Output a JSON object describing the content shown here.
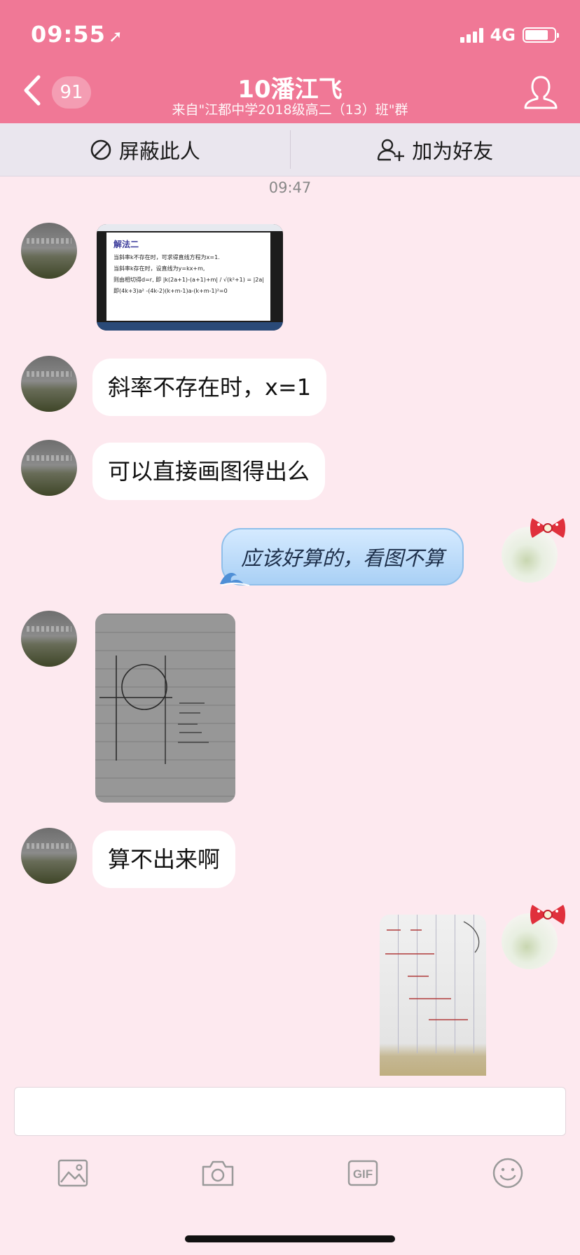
{
  "status_bar": {
    "time": "09:55",
    "network": "4G"
  },
  "header": {
    "unread_count": "91",
    "title": "10潘江飞",
    "subtitle": "来自\"江都中学2018级高二（13）班\"群"
  },
  "actions": {
    "block": "屏蔽此人",
    "add_friend": "加为好友"
  },
  "chat": {
    "timestamp": "09:47",
    "messages": [
      {
        "sender": "other",
        "type": "image"
      },
      {
        "sender": "other",
        "type": "text",
        "text": "斜率不存在时，x=1"
      },
      {
        "sender": "other",
        "type": "text",
        "text": "可以直接画图得出么"
      },
      {
        "sender": "self",
        "type": "text",
        "text": "应该好算的，看图不算"
      },
      {
        "sender": "other",
        "type": "image"
      },
      {
        "sender": "other",
        "type": "text",
        "text": "算不出来啊"
      },
      {
        "sender": "self",
        "type": "image"
      }
    ]
  },
  "image1": {
    "heading": "解法二",
    "line1": "当斜率k不存在时，可求得直线方程为x=1.",
    "line2": "当斜率k存在时，设直线为y=kx+m,",
    "line3": "则由相切得d=r, 即 |k(2a+1)-(a+1)+m| / √(k²+1) = |2a|",
    "line4": "即(4k+3)a² -(4k-2)(k+m-1)a-(k+m-1)²=0"
  },
  "toolbar": {
    "icons": [
      "image-icon",
      "camera-icon",
      "gif-icon",
      "emoji-icon"
    ],
    "gif_label": "GIF"
  },
  "colors": {
    "header_bg": "#f07896",
    "chat_bg": "#fde9ef",
    "action_bar_bg": "#eae6ee",
    "self_bubble": "#a9d0f5"
  }
}
